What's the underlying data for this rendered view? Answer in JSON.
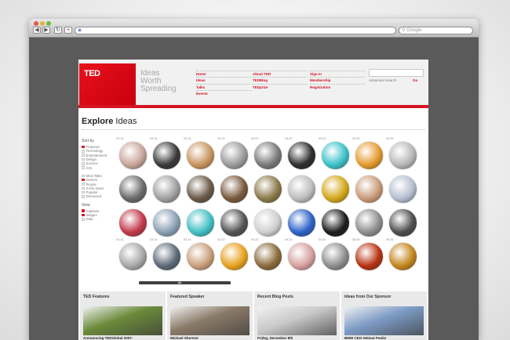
{
  "browser": {
    "url": "",
    "search_placeholder": "Google"
  },
  "header": {
    "logo": "TED",
    "tagline": [
      "Ideas",
      "Worth",
      "Spreading"
    ],
    "nav_columns": [
      [
        "Home",
        "Ideas",
        "Talks",
        "Events"
      ],
      [
        "About TED",
        "TEDBlog",
        "TEDprize"
      ],
      [
        "Sign In",
        "Membership",
        "Registration"
      ]
    ],
    "advanced_search": "Advanced Search",
    "go": "Go"
  },
  "explore": {
    "title_bold": "Explore",
    "title_rest": " Ideas"
  },
  "sidebar": {
    "sort_by": "Sort by",
    "sort_groups": [
      [
        {
          "label": "Featured",
          "checked": true
        },
        {
          "label": "Technology",
          "checked": false
        },
        {
          "label": "Entertainment",
          "checked": false
        },
        {
          "label": "Design",
          "checked": false
        },
        {
          "label": "Science",
          "checked": false
        },
        {
          "label": "Arts",
          "checked": false
        }
      ],
      [
        {
          "label": "Most Talks",
          "checked": false
        },
        {
          "label": "Newest",
          "checked": true
        },
        {
          "label": "People",
          "checked": false
        },
        {
          "label": "In the News",
          "checked": false
        },
        {
          "label": "Popular",
          "checked": false
        },
        {
          "label": "Discussed",
          "checked": false
        }
      ]
    ],
    "view": "View",
    "view_items": [
      {
        "label": "Captions",
        "checked": true
      },
      {
        "label": "Images",
        "checked": true
      },
      {
        "label": "Data",
        "checked": false
      }
    ]
  },
  "grid": {
    "rows": [
      {
        "date": "03.14",
        "dates": [
          "03.14",
          "03.14",
          "03.14",
          "04.22",
          "04.22",
          "04.22",
          "04.22",
          "05.26",
          "05.26"
        ],
        "colors": [
          "#c9a59a",
          "#3a3a3a",
          "#c8955e",
          "#9b9b9b",
          "#7a7a7a",
          "#2e2e2e",
          "#3cc2c9",
          "#e59a2e",
          "#b8b8b8"
        ]
      },
      {
        "date": "",
        "dates": [
          "",
          "",
          "",
          "",
          "",
          "",
          "",
          "",
          ""
        ],
        "colors": [
          "#6b6b6b",
          "#a0a0a0",
          "#6a5a48",
          "#7a5a3e",
          "#8a7a4a",
          "#bdbdbd",
          "#d4a81a",
          "#c99b78",
          "#b5bfd0"
        ]
      },
      {
        "date": "",
        "dates": [
          "",
          "",
          "",
          "",
          "",
          "",
          "",
          "",
          ""
        ],
        "colors": [
          "#c2394a",
          "#8aa0b5",
          "#42c0c4",
          "#555555",
          "#cfcfcf",
          "#2f63c9",
          "#1e1e1e",
          "#8e8e8e",
          "#4f4f4f"
        ]
      },
      {
        "date": "03.14",
        "dates": [
          "03.14",
          "03.14",
          "03.14",
          "04.22",
          "04.22",
          "04.22",
          "04.22",
          "05.26",
          "05.26"
        ],
        "colors": [
          "#a8a8a8",
          "#5d6a78",
          "#c9a07a",
          "#e8a21e",
          "#8a6a3a",
          "#d7a0a0",
          "#8d8d8d",
          "#b83210",
          "#c4861c"
        ]
      }
    ]
  },
  "features": [
    {
      "heading": "TED Features",
      "title": "Announcing TEDGlobal 2007:",
      "img": "#6a8a3a"
    },
    {
      "heading": "Featured Speaker",
      "title": "Michael Shermer",
      "img": "#8a7a68"
    },
    {
      "heading": "Recent Blog Posts",
      "title": "Friday, December 8th",
      "img": "#c9c9c9"
    },
    {
      "heading": "Ideas from Our Sponsor",
      "title": "BMW CEO Helmut Panke",
      "img": "#7d9bc5"
    }
  ]
}
